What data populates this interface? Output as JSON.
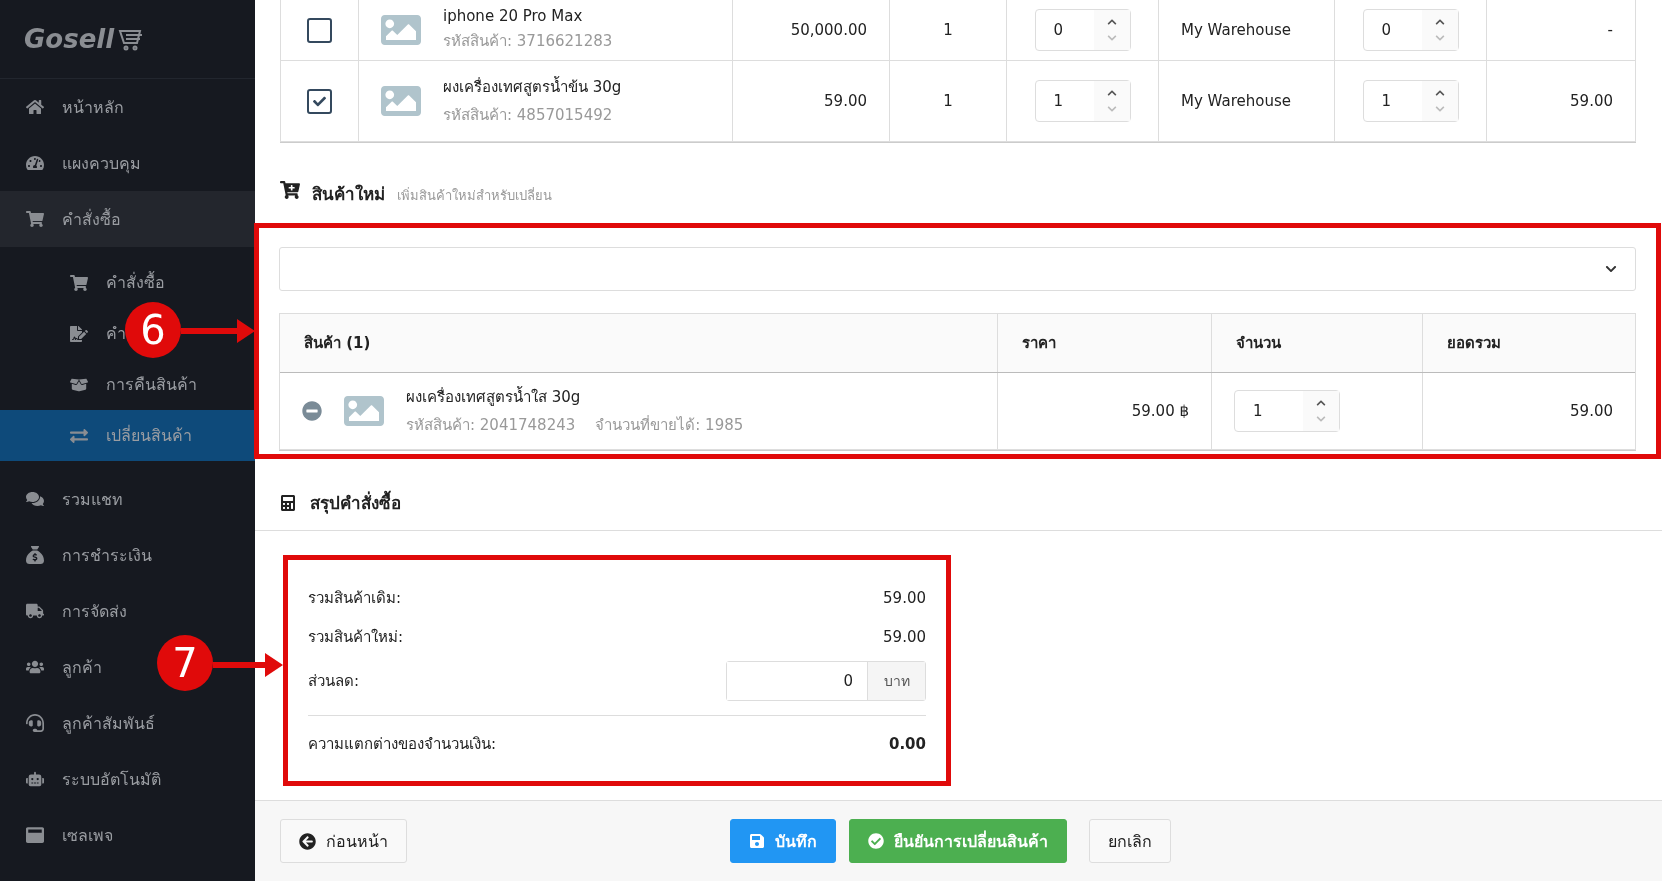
{
  "sidebar": {
    "logo": "Gosell",
    "items": [
      {
        "label": "หน้าหลัก",
        "selected": false
      },
      {
        "label": "แผงควบคุม",
        "selected": false
      },
      {
        "label": "คำสั่งซื้อ",
        "selected": false,
        "expanded": true,
        "children": [
          {
            "label": "คำสั่งซื้อ",
            "selected": false
          },
          {
            "label": "คำ",
            "selected": false
          },
          {
            "label": "การคืนสินค้า",
            "selected": false
          },
          {
            "label": "เปลี่ยนสินค้า",
            "selected": true
          }
        ]
      },
      {
        "label": "รวมแชท",
        "selected": false
      },
      {
        "label": "การชำระเงิน",
        "selected": false
      },
      {
        "label": "การจัดส่ง",
        "selected": false
      },
      {
        "label": "ลูกค้า",
        "selected": false
      },
      {
        "label": "ลูกค้าสัมพันธ์",
        "selected": false
      },
      {
        "label": "ระบบอัตโนมัติ",
        "selected": false
      },
      {
        "label": "เซลเพจ",
        "selected": false
      }
    ]
  },
  "original_items": {
    "rows": [
      {
        "checked": false,
        "product_name": "iphone 20 Pro Max",
        "product_code": "รหัสสินค้า: 3716621283",
        "column_3": "50,000.00",
        "column_4": "1",
        "column_5": "0",
        "column_6": "My Warehouse",
        "column_7": "0",
        "column_8": "-"
      },
      {
        "checked": true,
        "product_name": "ผงเครื่องเทศสูตรน้ำข้น 30g",
        "product_code": "รหัสสินค้า: 4857015492",
        "column_3": "59.00",
        "column_4": "1",
        "column_5": "1",
        "column_6": "My Warehouse",
        "column_7": "1",
        "column_8": "59.00"
      }
    ]
  },
  "new_items": {
    "title": "สินค้าใหม่",
    "subtitle": "เพิ่มสินค้าใหม่สำหรับเปลี่ยน",
    "columns": [
      "สินค้า (1)",
      "ราคา",
      "จำนวน",
      "ยอดรวม"
    ],
    "rows": [
      {
        "product_name": "ผงเครื่องเทศสูตรน้ำใส 30g",
        "product_code": "รหัสสินค้า: 2041748243",
        "available": "จำนวนที่ขายได้: 1985",
        "price": "59.00 ฿",
        "quantity": "1",
        "total": "59.00"
      }
    ]
  },
  "summary": {
    "title": "สรุปคำสั่งซื้อ",
    "original_total_label": "รวมสินค้าเดิม:",
    "original_total": "59.00",
    "new_total_label": "รวมสินค้าใหม่:",
    "new_total": "59.00",
    "discount_label": "ส่วนลด:",
    "discount": "0",
    "discount_unit": "บาท",
    "difference_label": "ความแตกต่างของจำนวนเงิน:",
    "difference": "0.00"
  },
  "footer": {
    "back": "ก่อนหน้า",
    "save": "บันทึก",
    "confirm": "ยืนยันการเปลี่ยนสินค้า",
    "cancel": "ยกเลิก"
  },
  "callouts": [
    {
      "label": "6"
    },
    {
      "label": "7"
    }
  ]
}
